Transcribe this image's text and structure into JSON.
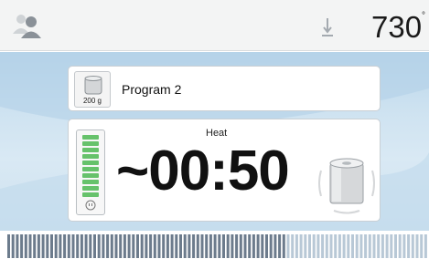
{
  "header": {
    "user_icon": "user-group-icon",
    "temperature_icon": "temperature-icon",
    "temperature_value": "730",
    "temperature_unit": "°"
  },
  "program": {
    "weight_label": "200 g",
    "name": "Program 2",
    "weight_icon": "muffle-weight-icon"
  },
  "status": {
    "phase": "Heat",
    "time": "~00:50",
    "battery_level": 1.0,
    "battery_icon": "plug-icon",
    "muffle_icon": "heating-cylinder-icon"
  },
  "progress": {
    "fraction": 0.66,
    "done_color": "#6c7b8c",
    "todo_color": "#b8c8d6"
  },
  "colors": {
    "accent_green": "#66c26b",
    "background_blue": "#cfe3f1"
  }
}
